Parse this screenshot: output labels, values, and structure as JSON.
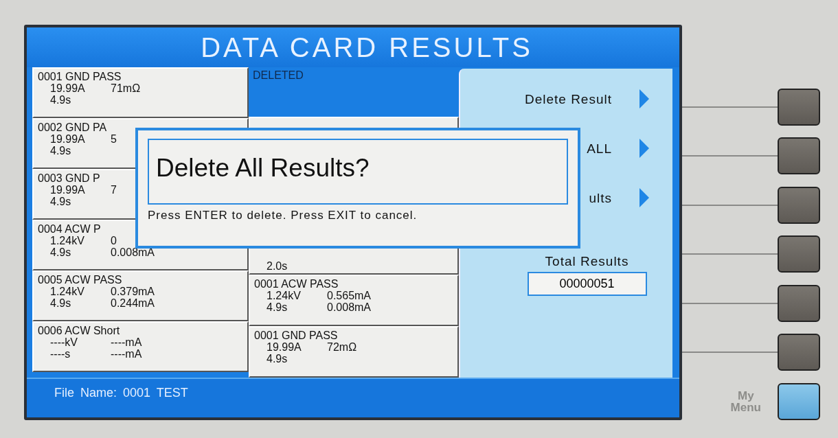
{
  "title": "DATA CARD RESULTS",
  "left_results": [
    {
      "kind": "result",
      "lines": [
        [
          "0001 GND PASS"
        ],
        [
          "19.99A",
          "71mΩ"
        ],
        [
          "4.9s"
        ]
      ]
    },
    {
      "kind": "result",
      "lines": [
        [
          "0002 GND PA"
        ],
        [
          "19.99A",
          "5"
        ],
        [
          "4.9s"
        ]
      ]
    },
    {
      "kind": "result",
      "lines": [
        [
          "0003 GND P"
        ],
        [
          "19.99A",
          "7"
        ],
        [
          "4.9s"
        ]
      ]
    },
    {
      "kind": "result",
      "lines": [
        [
          "0004 ACW P"
        ],
        [
          "1.24kV",
          "0"
        ],
        [
          "4.9s",
          "0.008mA"
        ]
      ]
    },
    {
      "kind": "result",
      "lines": [
        [
          "0005 ACW PASS"
        ],
        [
          "1.24kV",
          "0.379mA"
        ],
        [
          "4.9s",
          "0.244mA"
        ]
      ]
    },
    {
      "kind": "result",
      "lines": [
        [
          "0006 ACW Short"
        ],
        [
          "----kV",
          "----mA"
        ],
        [
          "----s",
          "----mA"
        ]
      ]
    }
  ],
  "right_results": [
    {
      "kind": "deleted",
      "lines": [
        [
          "DELETED"
        ]
      ]
    },
    {
      "kind": "covered",
      "lines": [
        [
          "2.0s"
        ]
      ]
    },
    {
      "kind": "result",
      "lines": [
        [
          "0001 ACW PASS"
        ],
        [
          "1.24kV",
          "0.565mA"
        ],
        [
          "4.9s",
          "0.008mA"
        ]
      ]
    },
    {
      "kind": "result",
      "lines": [
        [
          "0001 GND PASS"
        ],
        [
          "19.99A",
          "72mΩ"
        ],
        [
          "4.9s"
        ]
      ]
    }
  ],
  "menu": [
    {
      "label": "Delete Result"
    },
    {
      "label": "ALL"
    },
    {
      "label": "ults"
    }
  ],
  "total": {
    "label": "Total Results",
    "value": "00000051"
  },
  "status_bar": "File Name: 0001 TEST",
  "dialog": {
    "title": "Delete All Results?",
    "message": "Press ENTER to delete. Press EXIT to cancel."
  },
  "softkeys": [
    {
      "kind": "plain"
    },
    {
      "kind": "plain"
    },
    {
      "kind": "plain"
    },
    {
      "kind": "plain"
    },
    {
      "kind": "plain"
    },
    {
      "kind": "plain"
    },
    {
      "kind": "my_menu",
      "label": "My\nMenu"
    }
  ]
}
